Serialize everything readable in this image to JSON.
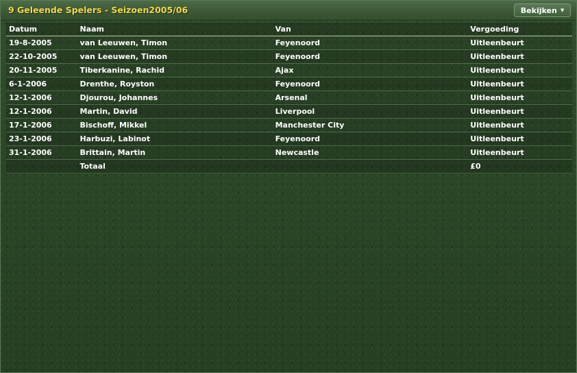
{
  "window": {
    "title": "9 Geleende Spelers - Seizoen2005/06",
    "view_button_label": "Bekijken",
    "view_button_icon": "chevron-down-icon"
  },
  "table": {
    "columns": [
      "Datum",
      "Naam",
      "Van",
      "Vergoeding"
    ],
    "rows": [
      {
        "datum": "19-8-2005",
        "naam": "van Leeuwen, Timon",
        "van": "Feyenoord",
        "vergoeding": "Uitleenbeurt"
      },
      {
        "datum": "22-10-2005",
        "naam": "van Leeuwen, Timon",
        "van": "Feyenoord",
        "vergoeding": "Uitleenbeurt"
      },
      {
        "datum": "20-11-2005",
        "naam": "Tiberkanine, Rachid",
        "van": "Ajax",
        "vergoeding": "Uitleenbeurt"
      },
      {
        "datum": "6-1-2006",
        "naam": "Drenthe, Royston",
        "van": "Feyenoord",
        "vergoeding": "Uitleenbeurt"
      },
      {
        "datum": "12-1-2006",
        "naam": "Djourou, Johannes",
        "van": "Arsenal",
        "vergoeding": "Uitleenbeurt"
      },
      {
        "datum": "12-1-2006",
        "naam": "Martin, David",
        "van": "Liverpool",
        "vergoeding": "Uitleenbeurt"
      },
      {
        "datum": "17-1-2006",
        "naam": "Bischoff, Mikkel",
        "van": "Manchester City",
        "vergoeding": "Uitleenbeurt"
      },
      {
        "datum": "23-1-2006",
        "naam": "Harbuzi, Labinot",
        "van": "Feyenoord",
        "vergoeding": "Uitleenbeurt"
      },
      {
        "datum": "31-1-2006",
        "naam": "Brittain, Martin",
        "van": "Newcastle",
        "vergoeding": "Uitleenbeurt"
      }
    ],
    "total": {
      "label": "Totaal",
      "value": "£0"
    }
  },
  "colors": {
    "title": "#f1d94a",
    "text": "#ffffff",
    "background": "#2c4728"
  }
}
